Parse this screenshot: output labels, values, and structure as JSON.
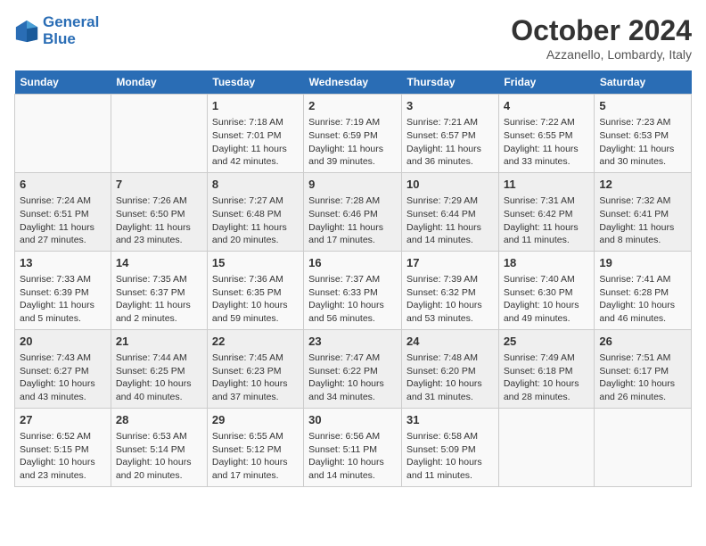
{
  "header": {
    "logo_line1": "General",
    "logo_line2": "Blue",
    "month": "October 2024",
    "location": "Azzanello, Lombardy, Italy"
  },
  "days_of_week": [
    "Sunday",
    "Monday",
    "Tuesday",
    "Wednesday",
    "Thursday",
    "Friday",
    "Saturday"
  ],
  "weeks": [
    [
      {
        "day": "",
        "info": ""
      },
      {
        "day": "",
        "info": ""
      },
      {
        "day": "1",
        "info": "Sunrise: 7:18 AM\nSunset: 7:01 PM\nDaylight: 11 hours and 42 minutes."
      },
      {
        "day": "2",
        "info": "Sunrise: 7:19 AM\nSunset: 6:59 PM\nDaylight: 11 hours and 39 minutes."
      },
      {
        "day": "3",
        "info": "Sunrise: 7:21 AM\nSunset: 6:57 PM\nDaylight: 11 hours and 36 minutes."
      },
      {
        "day": "4",
        "info": "Sunrise: 7:22 AM\nSunset: 6:55 PM\nDaylight: 11 hours and 33 minutes."
      },
      {
        "day": "5",
        "info": "Sunrise: 7:23 AM\nSunset: 6:53 PM\nDaylight: 11 hours and 30 minutes."
      }
    ],
    [
      {
        "day": "6",
        "info": "Sunrise: 7:24 AM\nSunset: 6:51 PM\nDaylight: 11 hours and 27 minutes."
      },
      {
        "day": "7",
        "info": "Sunrise: 7:26 AM\nSunset: 6:50 PM\nDaylight: 11 hours and 23 minutes."
      },
      {
        "day": "8",
        "info": "Sunrise: 7:27 AM\nSunset: 6:48 PM\nDaylight: 11 hours and 20 minutes."
      },
      {
        "day": "9",
        "info": "Sunrise: 7:28 AM\nSunset: 6:46 PM\nDaylight: 11 hours and 17 minutes."
      },
      {
        "day": "10",
        "info": "Sunrise: 7:29 AM\nSunset: 6:44 PM\nDaylight: 11 hours and 14 minutes."
      },
      {
        "day": "11",
        "info": "Sunrise: 7:31 AM\nSunset: 6:42 PM\nDaylight: 11 hours and 11 minutes."
      },
      {
        "day": "12",
        "info": "Sunrise: 7:32 AM\nSunset: 6:41 PM\nDaylight: 11 hours and 8 minutes."
      }
    ],
    [
      {
        "day": "13",
        "info": "Sunrise: 7:33 AM\nSunset: 6:39 PM\nDaylight: 11 hours and 5 minutes."
      },
      {
        "day": "14",
        "info": "Sunrise: 7:35 AM\nSunset: 6:37 PM\nDaylight: 11 hours and 2 minutes."
      },
      {
        "day": "15",
        "info": "Sunrise: 7:36 AM\nSunset: 6:35 PM\nDaylight: 10 hours and 59 minutes."
      },
      {
        "day": "16",
        "info": "Sunrise: 7:37 AM\nSunset: 6:33 PM\nDaylight: 10 hours and 56 minutes."
      },
      {
        "day": "17",
        "info": "Sunrise: 7:39 AM\nSunset: 6:32 PM\nDaylight: 10 hours and 53 minutes."
      },
      {
        "day": "18",
        "info": "Sunrise: 7:40 AM\nSunset: 6:30 PM\nDaylight: 10 hours and 49 minutes."
      },
      {
        "day": "19",
        "info": "Sunrise: 7:41 AM\nSunset: 6:28 PM\nDaylight: 10 hours and 46 minutes."
      }
    ],
    [
      {
        "day": "20",
        "info": "Sunrise: 7:43 AM\nSunset: 6:27 PM\nDaylight: 10 hours and 43 minutes."
      },
      {
        "day": "21",
        "info": "Sunrise: 7:44 AM\nSunset: 6:25 PM\nDaylight: 10 hours and 40 minutes."
      },
      {
        "day": "22",
        "info": "Sunrise: 7:45 AM\nSunset: 6:23 PM\nDaylight: 10 hours and 37 minutes."
      },
      {
        "day": "23",
        "info": "Sunrise: 7:47 AM\nSunset: 6:22 PM\nDaylight: 10 hours and 34 minutes."
      },
      {
        "day": "24",
        "info": "Sunrise: 7:48 AM\nSunset: 6:20 PM\nDaylight: 10 hours and 31 minutes."
      },
      {
        "day": "25",
        "info": "Sunrise: 7:49 AM\nSunset: 6:18 PM\nDaylight: 10 hours and 28 minutes."
      },
      {
        "day": "26",
        "info": "Sunrise: 7:51 AM\nSunset: 6:17 PM\nDaylight: 10 hours and 26 minutes."
      }
    ],
    [
      {
        "day": "27",
        "info": "Sunrise: 6:52 AM\nSunset: 5:15 PM\nDaylight: 10 hours and 23 minutes."
      },
      {
        "day": "28",
        "info": "Sunrise: 6:53 AM\nSunset: 5:14 PM\nDaylight: 10 hours and 20 minutes."
      },
      {
        "day": "29",
        "info": "Sunrise: 6:55 AM\nSunset: 5:12 PM\nDaylight: 10 hours and 17 minutes."
      },
      {
        "day": "30",
        "info": "Sunrise: 6:56 AM\nSunset: 5:11 PM\nDaylight: 10 hours and 14 minutes."
      },
      {
        "day": "31",
        "info": "Sunrise: 6:58 AM\nSunset: 5:09 PM\nDaylight: 10 hours and 11 minutes."
      },
      {
        "day": "",
        "info": ""
      },
      {
        "day": "",
        "info": ""
      }
    ]
  ]
}
